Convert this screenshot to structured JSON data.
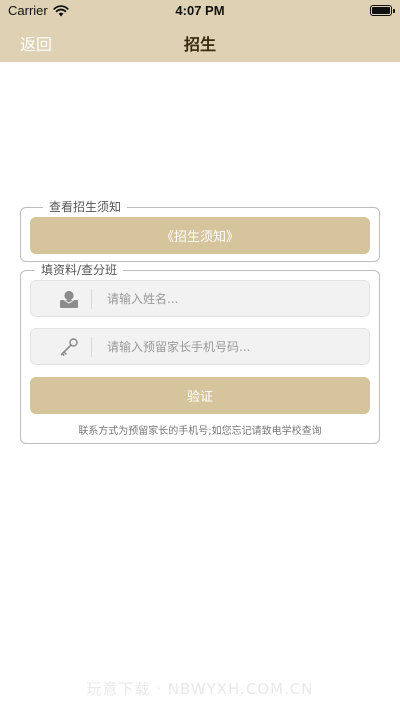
{
  "status_bar": {
    "carrier": "Carrier",
    "time": "4:07 PM",
    "icons": [
      "wifi-icon",
      "battery-icon"
    ]
  },
  "nav": {
    "back_label": "返回",
    "title": "招生"
  },
  "notice_section": {
    "legend": "查看招生须知",
    "button_label": "《招生须知》"
  },
  "form_section": {
    "legend": "填资料/查分班",
    "name_input": {
      "placeholder": "请输入姓名...",
      "value": "",
      "icon": "user-icon"
    },
    "phone_input": {
      "placeholder": "请输入预留家长手机号码...",
      "value": "",
      "icon": "key-icon"
    },
    "verify_label": "验证",
    "footnote": "联系方式为预留家长的手机号;如您忘记请致电学校查询"
  },
  "watermark": "玩意下载 · NBWYXH.COM.CN",
  "colors": {
    "header_bg": "#dfd1b4",
    "button_bg": "#d6c59c",
    "input_bg": "#f2f2f2",
    "border": "#bdbdbd"
  }
}
